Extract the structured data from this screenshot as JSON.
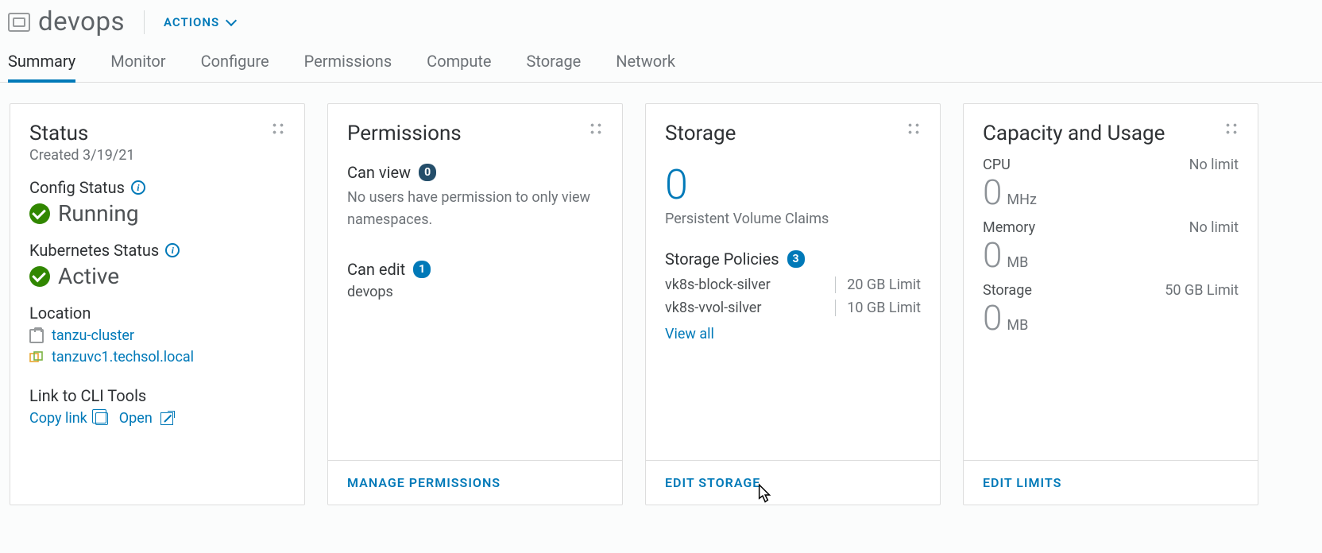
{
  "header": {
    "title": "devops",
    "actions_label": "ACTIONS"
  },
  "tabs": [
    "Summary",
    "Monitor",
    "Configure",
    "Permissions",
    "Compute",
    "Storage",
    "Network"
  ],
  "active_tab": "Summary",
  "status_card": {
    "title": "Status",
    "created_label": "Created 3/19/21",
    "config_status_label": "Config Status",
    "config_status_value": "Running",
    "k8s_status_label": "Kubernetes Status",
    "k8s_status_value": "Active",
    "location_label": "Location",
    "cluster": "tanzu-cluster",
    "vcenter": "tanzuvc1.techsol.local",
    "cli_tools_label": "Link to CLI Tools",
    "copy_link_label": "Copy link",
    "open_label": "Open"
  },
  "permissions_card": {
    "title": "Permissions",
    "can_view_label": "Can view",
    "can_view_count": "0",
    "can_view_desc": "No users have permission to only view namespaces.",
    "can_edit_label": "Can edit",
    "can_edit_count": "1",
    "can_edit_entries": [
      "devops"
    ],
    "footer": "MANAGE PERMISSIONS"
  },
  "storage_card": {
    "title": "Storage",
    "pvc_count": "0",
    "pvc_label": "Persistent Volume Claims",
    "policies_label": "Storage Policies",
    "policies_count": "3",
    "policies": [
      {
        "name": "vk8s-block-silver",
        "limit": "20 GB Limit"
      },
      {
        "name": "vk8s-vvol-silver",
        "limit": "10 GB Limit"
      }
    ],
    "view_all_label": "View all",
    "footer": "EDIT STORAGE"
  },
  "capacity_card": {
    "title": "Capacity and Usage",
    "rows": [
      {
        "label": "CPU",
        "limit": "No limit",
        "value": "0",
        "unit": "MHz"
      },
      {
        "label": "Memory",
        "limit": "No limit",
        "value": "0",
        "unit": "MB"
      },
      {
        "label": "Storage",
        "limit": "50 GB Limit",
        "value": "0",
        "unit": "MB"
      }
    ],
    "footer": "EDIT LIMITS"
  }
}
